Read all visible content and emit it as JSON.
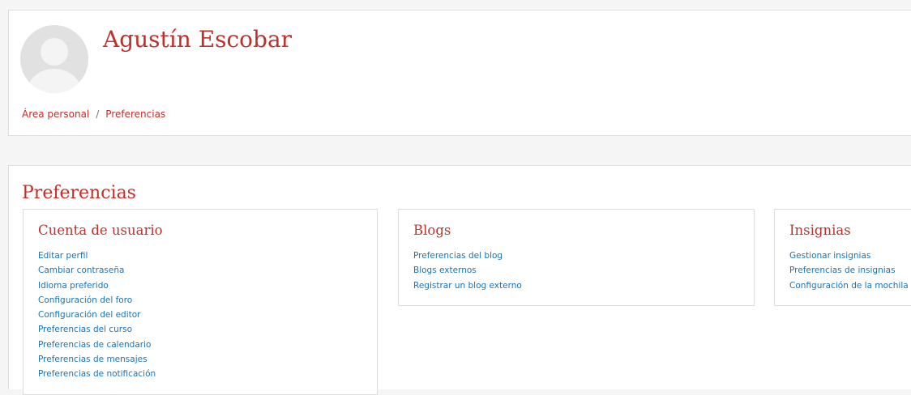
{
  "header": {
    "user_name": "Agustín Escobar",
    "breadcrumb": [
      {
        "label": "Área personal"
      },
      {
        "label": "Preferencias"
      }
    ],
    "breadcrumb_separator": "/"
  },
  "page": {
    "title": "Preferencias",
    "sections": [
      {
        "title": "Cuenta de usuario",
        "links": [
          "Editar perfil",
          "Cambiar contraseña",
          "Idioma preferido",
          "Configuración del foro",
          "Configuración del editor",
          "Preferencias del curso",
          "Preferencias de calendario",
          "Preferencias de mensajes",
          "Preferencias de notificación"
        ]
      },
      {
        "title": "Blogs",
        "links": [
          "Preferencias del blog",
          "Blogs externos",
          "Registrar un blog externo"
        ]
      },
      {
        "title": "Insignias",
        "links": [
          "Gestionar insignias",
          "Preferencias de insignias",
          "Configuración de la mochila"
        ]
      }
    ]
  },
  "colors": {
    "brand_red": "#c0302b",
    "link_blue": "#1a73b8",
    "border": "#dddddd",
    "background": "#f5f5f5"
  },
  "icons": {
    "avatar": "default-user-avatar-icon"
  }
}
